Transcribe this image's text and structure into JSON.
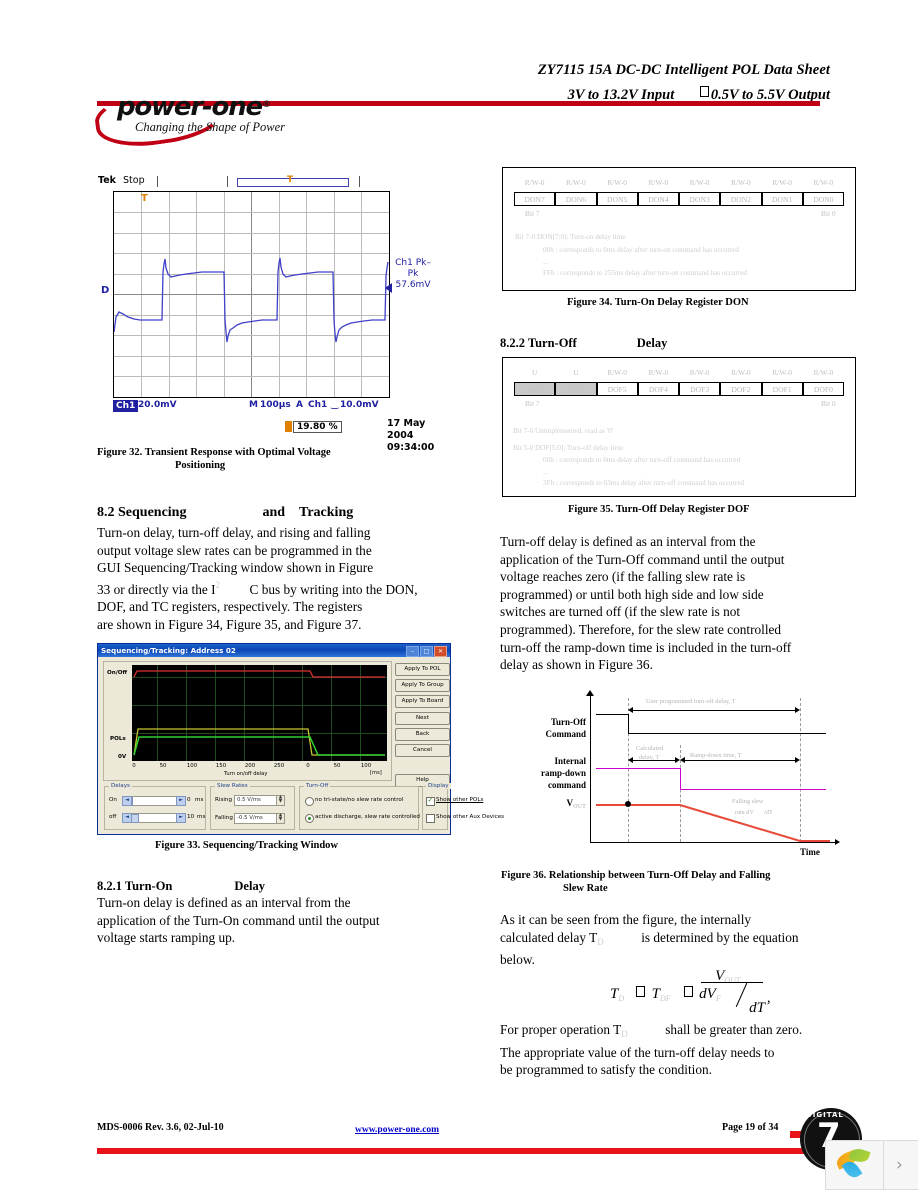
{
  "header": {
    "title": "ZY7115 15A DC-DC Intelligent POL Data Sheet",
    "sub_left": "3V to 13.2V Input",
    "sub_right": "0.5V to 5.5V Output",
    "logo_text": "power-one",
    "logo_reg": "®",
    "logo_tagline": "Changing the Shape of Power"
  },
  "scope": {
    "brand": "Tek",
    "state": "Stop",
    "trigger_marker": "T",
    "channel_badge": "Ch1",
    "vert_scale": "20.0mV",
    "timebase_label": "M",
    "timebase": "100µs",
    "trig_src_label": "A",
    "trig_src": "Ch1",
    "trig_level": "10.0mV",
    "measure_label": "Ch1 Pk–Pk",
    "measure_value": "57.6mV",
    "dmark": "D",
    "position_pct": "19.80 %",
    "date": "17 May 2004",
    "time": "09:34:00"
  },
  "figures": {
    "fig32": "Figure 32.  Transient Response with Optimal Voltage",
    "fig32b": "Positioning",
    "fig33": "Figure 33.  Sequencing/Tracking Window",
    "fig34": "Figure 34.  Turn-On Delay Register DON",
    "fig35": "Figure 35.  Turn-Off Delay Register DOF",
    "fig36": "Figure 36. Relationship between Turn-Off Delay and Falling",
    "fig36b": "Slew Rate"
  },
  "sections": {
    "s82_num": "8.2 Sequencing",
    "s82_and": "and",
    "s82_tracking": "Tracking",
    "s82_body": [
      "Turn-on delay, turn-off delay, and rising and falling",
      "output voltage slew rates can be programmed in the",
      "GUI Sequencing/Tracking window shown in Figure",
      "33 or directly via the I",
      "C bus by writing into the DON,",
      "DOF, and TC registers, respectively.  The registers",
      "are shown in Figure 34, Figure 35, and Figure 37."
    ],
    "s82_sup": "2",
    "s821_num": "8.2.1 Turn-On",
    "s821_delay": "Delay",
    "s821_body": [
      "Turn-on delay is defined as an interval from the",
      "application of the Turn-On command until the output",
      "voltage starts ramping up."
    ],
    "s822_num": "8.2.2 Turn-Off",
    "s822_delay": "Delay",
    "s822_body": [
      "Turn-off delay is defined as an interval from the",
      "application of the Turn-Off command until the output",
      "voltage reaches zero (if the falling slew rate is",
      "programmed) or until both high side and low side",
      "switches are turned off (if the slew rate is not",
      "programmed).  Therefore, for the slew rate controlled",
      "turn-off the ramp-down time is included in the turn-off",
      "delay as shown in Figure 36."
    ],
    "eq_intro": [
      "As it can be seen from the figure, the internally",
      "calculated delay T",
      "is determined by the equation",
      "below."
    ],
    "eq_outro": [
      "For proper operation T",
      "shall be greater than zero.",
      "The appropriate value of the turn-off delay needs to",
      "be programmed to satisfy the condition."
    ]
  },
  "equation": {
    "T": "T",
    "sub_D": "D",
    "eq_op1": "=",
    "T2": "T",
    "sub_DF": "DF",
    "eq_op2": "−",
    "V": "V",
    "sub_OUT": "OUT",
    "dV": "dV",
    "sub_F": "F",
    "dT": "dT",
    "comma": ","
  },
  "don_register": {
    "rw_labels": [
      "R/W-0",
      "R/W-0",
      "R/W-0",
      "R/W-0",
      "R/W-0",
      "R/W-0",
      "R/W-0",
      "R/W-0"
    ],
    "cells": [
      "DON7",
      "DON6",
      "DON5",
      "DON4",
      "DON3",
      "DON2",
      "DON1",
      "DON0"
    ],
    "bit_hi": "Bit 7",
    "bit_lo": "Bit 0",
    "notes": [
      "Bit 7-0  DON[7:0]: Turn-on delay time",
      "00h : corresponds to 0ms delay after turn-on command has occurred",
      "...",
      "FFh : corresponds to 255ms delay after turn-on command has occurred"
    ]
  },
  "dof_register": {
    "rw_labels": [
      "U",
      "U",
      "R/W-0",
      "R/W-0",
      "R/W-0",
      "R/W-0",
      "R/W-0",
      "R/W-0"
    ],
    "cells": [
      "—",
      "—",
      "DOF5",
      "DOF4",
      "DOF3",
      "DOF2",
      "DOF1",
      "DOF0"
    ],
    "bit_hi": "Bit 7",
    "bit_lo": "Bit 0",
    "notes": [
      "Bit 7-6  Unimplemented, read as '0'",
      "Bit 5-0  DOF[5:0]: Turn-off delay time",
      "00h : corresponds to 0ms delay after turn-off command has occurred",
      "...",
      "3Fh : corresponds to 63ms delay after turn-off command has occurred"
    ]
  },
  "gui": {
    "title": "Sequencing/Tracking: Address 02",
    "win_min": "–",
    "win_max": "□",
    "win_close": "✕",
    "y_labels": [
      "On/Off",
      "POLs",
      "0V"
    ],
    "x_ticks_left": [
      "0",
      "50",
      "100",
      "150",
      "200",
      "250"
    ],
    "x_ticks_right": [
      "0",
      "50",
      "100"
    ],
    "x_axis_name": "Turn on/off delay",
    "x_units": "[ms]",
    "buttons": [
      "Apply To POL",
      "Apply To Group",
      "Apply To Board",
      "Next",
      "Back",
      "Cancel"
    ],
    "help_button": "Help",
    "delays_group": "Delays",
    "delay_on_label": "On",
    "delay_on_value": "0",
    "delay_on_unit": "ms",
    "delay_off_label": "off",
    "delay_off_value": "10",
    "delay_off_unit": "ms",
    "slew_group": "Slew Rates",
    "slew_rising_label": "Rising",
    "slew_rising_value": "0.5 V/ms",
    "slew_falling_label": "Falling",
    "slew_falling_value": "-0.5 V/ms",
    "turnoff_group": "Turn-Off",
    "turnoff_opt1": "no tri-state/no slew rate control",
    "turnoff_opt2": "active discharge, slew rate controlled",
    "display_group": "Display",
    "display_opt1": "Show other POLs",
    "display_opt2": "Show other Aux Devices",
    "arrow_left": "◄",
    "arrow_right": "►"
  },
  "fig36_labels": {
    "turnoff_cmd_l1": "Turn-Off",
    "turnoff_cmd_l2": "Command",
    "internal_l1": "Internal",
    "internal_l2": "ramp-down",
    "internal_l3": "command",
    "vout": "V",
    "vout_sub": "OUT",
    "user_delay": "User programmed turn-off delay, T",
    "user_delay_sub": "DF",
    "calc_l1": "Calculated",
    "calc_l2": "delay, T",
    "calc_sub": "D",
    "rampdown": "Ramp-down time, T",
    "rampdown_sub": "RD",
    "falling_l1": "Falling slew",
    "falling_l2": "rate dV",
    "falling_l2b": "/dT",
    "falling_sub": "F",
    "time_axis": "Time"
  },
  "footer": {
    "left": "MDS-0006 Rev. 3.6, 02-Jul-10",
    "center": "www.power-one.com",
    "right": "Page 19 of 34",
    "logo_word": "DIGITAL",
    "logo_num": "7",
    "overlay_chevron": "›"
  },
  "colors": {
    "brand_red": "#c00014",
    "footer_red": "#e8131a",
    "scope_trace": "#4040c8",
    "title_bar": "#0a46b4"
  }
}
